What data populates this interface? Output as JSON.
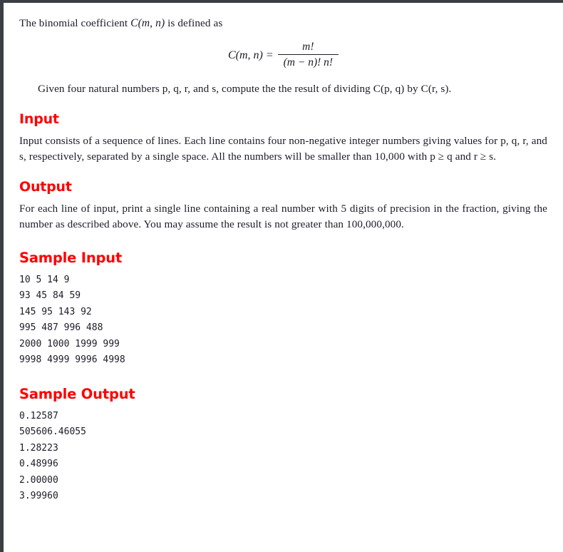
{
  "problem": {
    "intro": "The binomial coefficient C(m, n) is defined as",
    "intro_pre": "The binomial coefficient ",
    "intro_sym": "C(m, n)",
    "intro_post": " is defined as",
    "formula": {
      "lhs": "C(m, n) =",
      "numerator": "m!",
      "denominator": "(m − n)! n!",
      "plain": "C(m,n) = m! / ((m - n)! n!)"
    },
    "given_line": "Given four natural numbers p, q, r, and s, compute the the result of dividing C(p, q) by C(r, s)."
  },
  "sections": {
    "input": {
      "heading": "Input",
      "paragraph": "Input consists of a sequence of lines. Each line contains four non-negative integer numbers giving values for p, q, r, and s, respectively, separated by a single space. All the numbers will be smaller than 10,000 with p ≥ q and r ≥ s."
    },
    "output": {
      "heading": "Output",
      "paragraph": "For each line of input, print a single line containing a real number with 5 digits of precision in the fraction, giving the number as described above. You may assume the result is not greater than 100,000,000."
    },
    "sample_input": {
      "heading": "Sample Input",
      "lines": [
        "10 5 14 9",
        "93 45 84 59",
        "145 95 143 92",
        "995 487 996 488",
        "2000 1000 1999 999",
        "9998 4999 9996 4998"
      ],
      "text": "10 5 14 9\n93 45 84 59\n145 95 143 92\n995 487 996 488\n2000 1000 1999 999\n9998 4999 9996 4998"
    },
    "sample_output": {
      "heading": "Sample Output",
      "lines": [
        "0.12587",
        "505606.46055",
        "1.28223",
        "0.48996",
        "2.00000",
        "3.99960"
      ],
      "text": "0.12587\n505606.46055\n1.28223\n0.48996\n2.00000\n3.99960"
    }
  },
  "colors": {
    "heading": "#ff0000",
    "body_text": "#1c1c28",
    "border": "#3b3f43",
    "background": "#ffffff"
  }
}
